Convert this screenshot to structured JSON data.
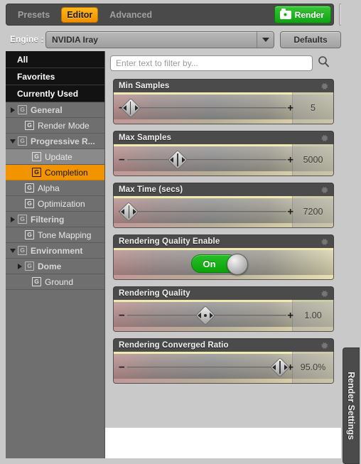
{
  "topbar": {
    "tabs": [
      {
        "label": "Presets",
        "active": false
      },
      {
        "label": "Editor",
        "active": true
      },
      {
        "label": "Advanced",
        "active": false
      }
    ],
    "render_button": {
      "label": "Render",
      "icon": "camera-icon",
      "color": "#19a71c"
    },
    "menu_icon": "options-menu-icon"
  },
  "engine_row": {
    "label": "Engine :",
    "selected": "NVIDIA Iray",
    "dropdown_icon": "chevron-down-icon",
    "defaults_label": "Defaults"
  },
  "sidebar": {
    "headers": [
      "All",
      "Favorites",
      "Currently Used"
    ],
    "items": [
      {
        "label": "General",
        "badge": "G",
        "twisty": "right",
        "indent": 0,
        "bold": true,
        "state": "normal"
      },
      {
        "label": "Render Mode",
        "badge": "G",
        "twisty": "none",
        "indent": 1,
        "bold": false,
        "state": "normal"
      },
      {
        "label": "Progressive R...",
        "badge": "G",
        "twisty": "down",
        "indent": 0,
        "bold": true,
        "state": "normal"
      },
      {
        "label": "Update",
        "badge": "G",
        "twisty": "none",
        "indent": 2,
        "bold": false,
        "state": "hover"
      },
      {
        "label": "Completion",
        "badge": "G",
        "twisty": "none",
        "indent": 2,
        "bold": false,
        "state": "selected"
      },
      {
        "label": "Alpha",
        "badge": "G",
        "twisty": "none",
        "indent": 1,
        "bold": false,
        "state": "normal"
      },
      {
        "label": "Optimization",
        "badge": "G",
        "twisty": "none",
        "indent": 1,
        "bold": false,
        "state": "normal"
      },
      {
        "label": "Filtering",
        "badge": "G",
        "twisty": "right",
        "indent": 0,
        "bold": true,
        "state": "normal"
      },
      {
        "label": "Tone Mapping",
        "badge": "G",
        "twisty": "none",
        "indent": 1,
        "bold": false,
        "state": "normal"
      },
      {
        "label": "Environment",
        "badge": "G",
        "twisty": "down",
        "indent": 0,
        "bold": true,
        "state": "normal"
      },
      {
        "label": "Dome",
        "badge": "G",
        "twisty": "right",
        "indent": 1,
        "bold": true,
        "state": "normal"
      },
      {
        "label": "Ground",
        "badge": "G",
        "twisty": "none",
        "indent": 2,
        "bold": false,
        "state": "normal"
      }
    ],
    "selected_color": "#f29400"
  },
  "filter": {
    "placeholder": "Enter text to filter by...",
    "value": "",
    "search_icon": "search-icon"
  },
  "properties": [
    {
      "name": "Min Samples",
      "type": "slider",
      "value": "5",
      "knob_pct": 2,
      "gear_icon": "gear-icon"
    },
    {
      "name": "Max Samples",
      "type": "slider",
      "value": "5000",
      "knob_pct": 31,
      "gear_icon": "gear-icon"
    },
    {
      "name": "Max Time (secs)",
      "type": "slider",
      "value": "7200",
      "knob_pct": 1,
      "gear_icon": "gear-icon"
    },
    {
      "name": "Rendering Quality Enable",
      "type": "toggle",
      "value": "On",
      "on": true,
      "gear_icon": "gear-icon"
    },
    {
      "name": "Rendering Quality",
      "type": "slider",
      "value": "1.00",
      "knob_pct": 48,
      "gear_icon": "gear-icon",
      "knob_style": "dot"
    },
    {
      "name": "Rendering Converged Ratio",
      "type": "slider",
      "value": "95.0%",
      "knob_pct": 94,
      "gear_icon": "gear-icon"
    }
  ],
  "right_tab": {
    "label": "Render Settings"
  }
}
